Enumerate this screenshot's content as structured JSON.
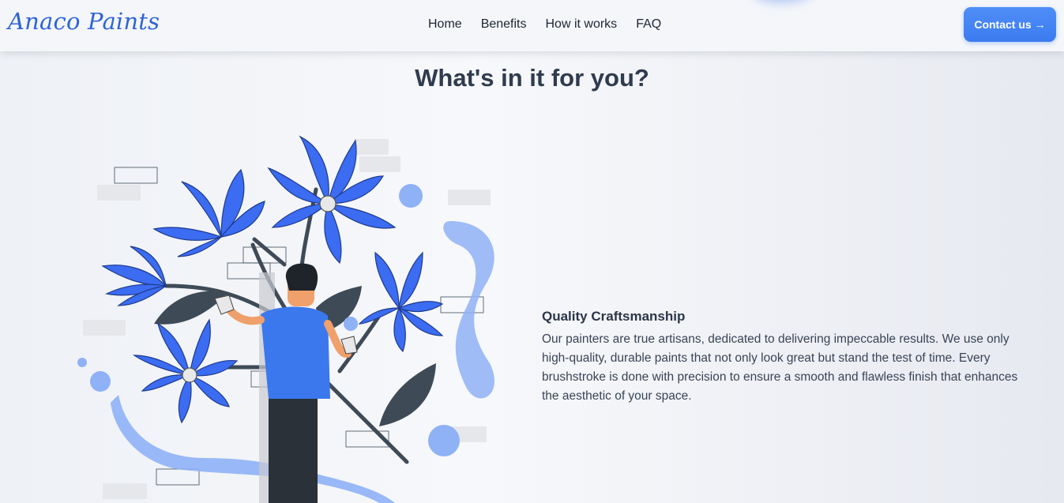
{
  "brand": {
    "name": "Anaco Paints"
  },
  "nav": {
    "links": [
      "Home",
      "Benefits",
      "How it works",
      "FAQ"
    ],
    "contact_label": "Contact us",
    "contact_arrow": "→"
  },
  "section": {
    "title": "What's in it for you?"
  },
  "benefit": {
    "title": "Quality Craftsmanship",
    "text": "Our painters are true artisans, dedicated to delivering impeccable results. We use only high-quality, durable paints that not only look great but stand the test of time. Every brushstroke is done with precision to ensure a smooth and flawless finish that enhances the aesthetic of your space."
  },
  "illustration": {
    "name": "painter-flowers-illustration"
  },
  "colors": {
    "brand": "#2e63d8",
    "accent": "#3b7bf0",
    "text_dark": "#2f3b4e",
    "flower_blue": "#3b6cf2",
    "leaf_dark": "#3e4b57"
  }
}
